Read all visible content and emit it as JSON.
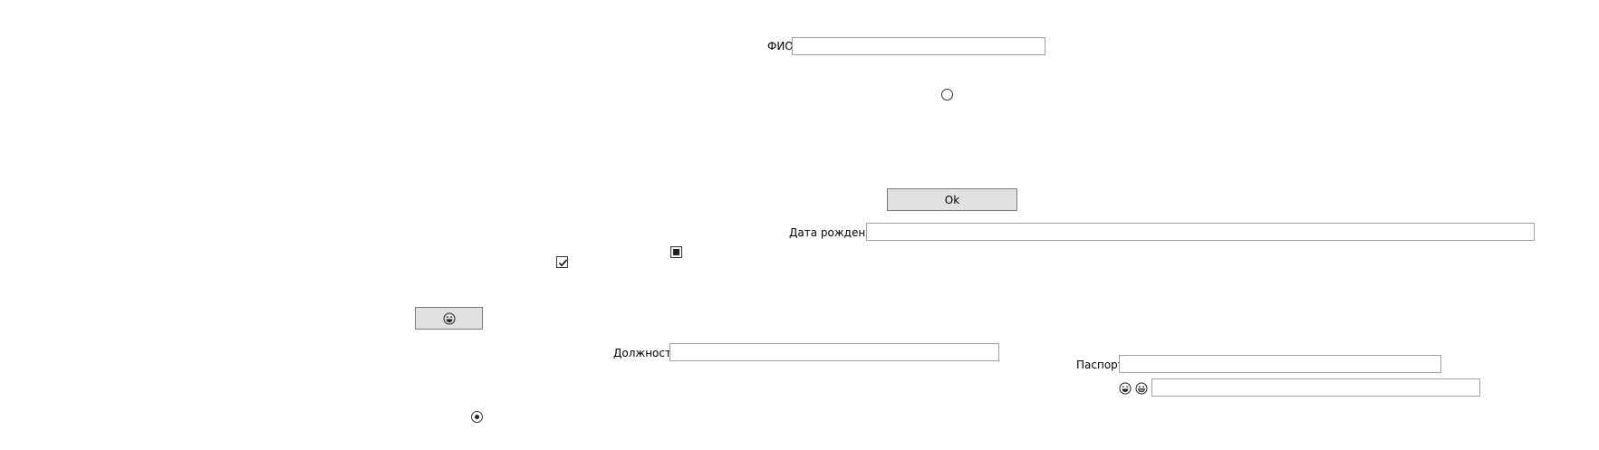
{
  "form": {
    "fio_label": "ФИО",
    "fio_value": "",
    "ok_button_label": "Ok",
    "birthdate_label": "Дата рождения",
    "birthdate_value": "",
    "position_label": "Должность",
    "position_value": "",
    "passport_label": "Паспорт",
    "passport_value": "",
    "emoji_field_value": "",
    "emoji_button_icon": "laughing-face-icon",
    "emoji_label_icons": [
      "laughing-face-icon",
      "grinning-face-icon"
    ],
    "checkbox_checked": true,
    "checkbox_indeterminate": true,
    "radio_top_selected": false,
    "radio_bottom_selected": true
  }
}
